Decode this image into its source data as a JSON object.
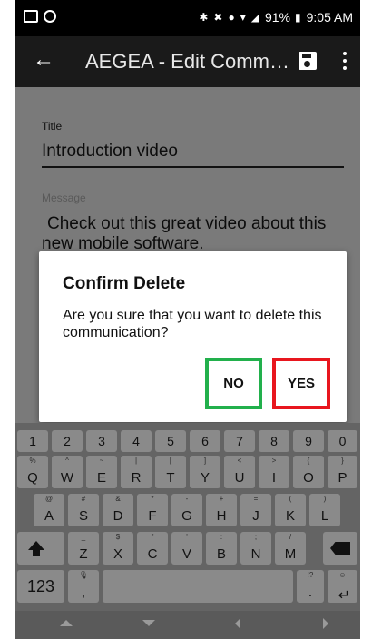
{
  "status_bar": {
    "battery": "91%",
    "time": "9:05 AM",
    "icons": [
      "email-icon",
      "skype-icon",
      "bluetooth-icon",
      "mute-icon",
      "alarm-icon",
      "wifi-icon",
      "signal-icon",
      "battery-icon"
    ]
  },
  "app_bar": {
    "title": "AEGEA - Edit Comm…",
    "back_icon": "arrow-left-icon",
    "save_icon": "floppy-disk-icon",
    "more_icon": "more-vertical-icon"
  },
  "form": {
    "title_label": "Title",
    "title_value": "Introduction video",
    "message_label": "Message",
    "message_value": "Check out this great video about this new mobile software."
  },
  "dialog": {
    "title": "Confirm Delete",
    "message": "Are you sure that you want to delete this communication?",
    "no_label": "NO",
    "yes_label": "YES",
    "no_highlight_color": "#22b04c",
    "yes_highlight_color": "#e8161e"
  },
  "keyboard": {
    "number_row": [
      "1",
      "2",
      "3",
      "4",
      "5",
      "6",
      "7",
      "8",
      "9",
      "0"
    ],
    "row1": {
      "keys": [
        "Q",
        "W",
        "E",
        "R",
        "T",
        "Y",
        "U",
        "I",
        "O",
        "P"
      ],
      "subs": [
        "%",
        "^",
        "~",
        "|",
        "[",
        "]",
        "<",
        ">",
        "{",
        "}"
      ]
    },
    "row2": {
      "keys": [
        "A",
        "S",
        "D",
        "F",
        "G",
        "H",
        "J",
        "K",
        "L"
      ],
      "subs": [
        "@",
        "#",
        "&",
        "*",
        "-",
        "+",
        "=",
        "(",
        ")"
      ]
    },
    "row3": {
      "keys": [
        "Z",
        "X",
        "C",
        "V",
        "B",
        "N",
        "M"
      ],
      "subs": [
        "_",
        "$",
        "\"",
        "'",
        ":",
        ";",
        "/"
      ]
    },
    "mode_key": "123",
    "comma_key": ",",
    "comma_sub": "🎙",
    "period_key": ".",
    "period_sub": "!?",
    "enter_sub": "☺"
  }
}
